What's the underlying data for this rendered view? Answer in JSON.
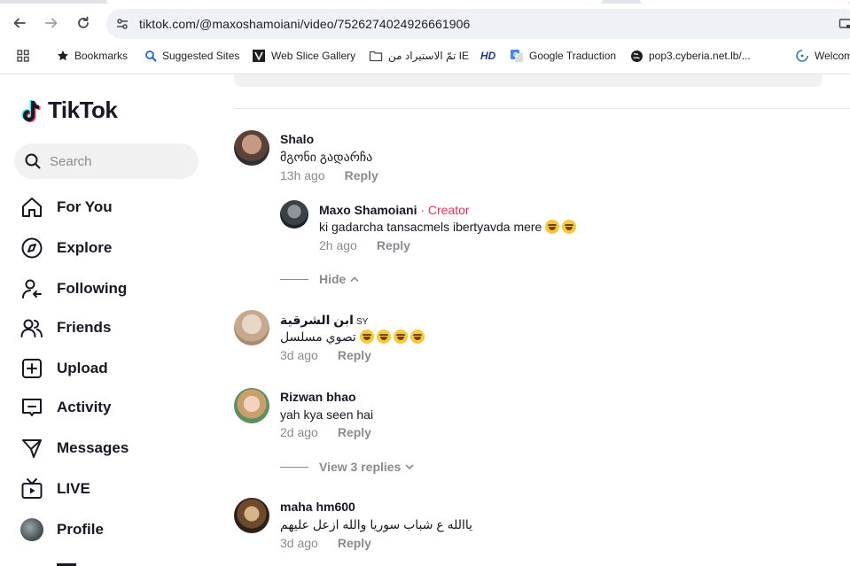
{
  "browser": {
    "url": "tiktok.com/@maxoshamoiani/video/7526274024926661906",
    "bookmarks": [
      {
        "label": "Bookmarks",
        "icon": "star-icon"
      },
      {
        "label": "Suggested Sites",
        "icon": "suggested-sites-icon"
      },
      {
        "label": "Web Slice Gallery",
        "icon": "web-slice-icon"
      },
      {
        "label": "تمّ الاستيراد من IE",
        "icon": "folder-icon"
      },
      {
        "label": "",
        "icon": "hd-icon"
      },
      {
        "label": "Google Traduction",
        "icon": "google-translate-icon"
      },
      {
        "label": "pop3.cyberia.net.lb/...",
        "icon": "globe-icon"
      },
      {
        "label": "Welcom",
        "icon": "welcome-icon"
      }
    ],
    "hd_text": "HD"
  },
  "sidebar": {
    "logo": "TikTok",
    "search_placeholder": "Search",
    "items": [
      {
        "label": "For You",
        "icon": "home-icon"
      },
      {
        "label": "Explore",
        "icon": "compass-icon"
      },
      {
        "label": "Following",
        "icon": "following-icon"
      },
      {
        "label": "Friends",
        "icon": "friends-icon"
      },
      {
        "label": "Upload",
        "icon": "upload-icon"
      },
      {
        "label": "Activity",
        "icon": "activity-icon"
      },
      {
        "label": "Messages",
        "icon": "messages-icon"
      },
      {
        "label": "LIVE",
        "icon": "live-icon"
      },
      {
        "label": "Profile",
        "icon": "profile-avatar"
      }
    ]
  },
  "comments": [
    {
      "user": "Shalo",
      "text": "მგონი გადარჩა",
      "time": "13h ago",
      "reply_label": "Reply",
      "replies": [
        {
          "user": "Maxo Shamoiani",
          "creator_tag": " · Creator",
          "text": "ki gadarcha tansacmels ibertyavda mere",
          "time": "2h ago",
          "reply_label": "Reply"
        }
      ],
      "thread_control": "Hide"
    },
    {
      "user": "ابن الشرقية",
      "badge": "SY",
      "text": "تصوي مسلسل",
      "time": "3d ago",
      "reply_label": "Reply"
    },
    {
      "user": "Rizwan bhao",
      "text": "yah kya seen hai",
      "time": "2d ago",
      "reply_label": "Reply",
      "thread_control": "View 3 replies"
    },
    {
      "user": "maha hm600",
      "text": "ياالله ع شباب سوريا والله ازعل عليهم",
      "time": "3d ago",
      "reply_label": "Reply"
    }
  ],
  "colors": {
    "creator": "#fe2c55",
    "meta": "#8a8b91",
    "text": "#161823"
  }
}
